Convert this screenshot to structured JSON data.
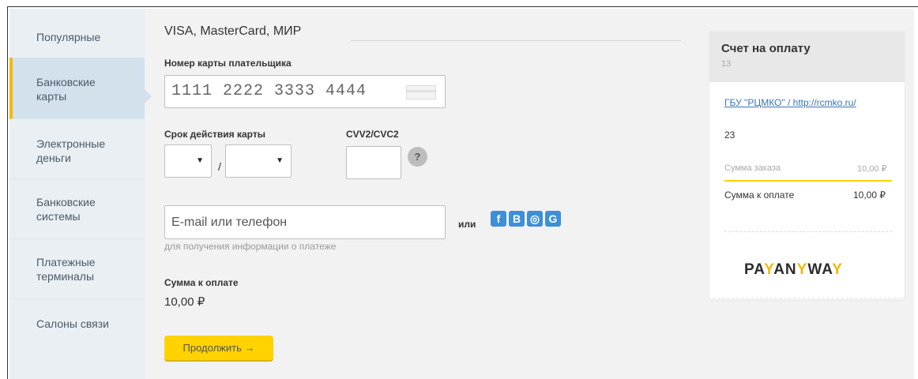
{
  "sidebar": {
    "items": [
      {
        "label": "Популярные"
      },
      {
        "label": "Банковские карты"
      },
      {
        "label": "Электронные деньги"
      },
      {
        "label": "Банковские системы"
      },
      {
        "label": "Платежные терминалы"
      },
      {
        "label": "Салоны связи"
      }
    ],
    "active_index": 1
  },
  "form": {
    "section_title": "VISA, MasterCard, МИР",
    "card_label": "Номер карты плательщика",
    "card_value": "1111 2222 3333 4444",
    "expiry_label": "Срок действия карты",
    "expiry_separator": "/",
    "cvv_label": "CVV2/CVC2",
    "help_symbol": "?",
    "email_placeholder": "E-mail или телефон",
    "or_label": "или",
    "social": [
      {
        "icon": "facebook-icon",
        "glyph": "f"
      },
      {
        "icon": "vk-icon",
        "glyph": "B"
      },
      {
        "icon": "odnoklassniki-icon",
        "glyph": "◎"
      },
      {
        "icon": "google-icon",
        "glyph": "G"
      }
    ],
    "email_hint": "для получения информации о платеже",
    "amount_label": "Сумма к оплате",
    "amount_value": "10,00 ₽",
    "continue_label": "Продолжить →"
  },
  "receipt": {
    "title": "Счет на оплату",
    "number": "13",
    "merchant": "ГБУ \"РЦМКО\" / http://rcmko.ru/",
    "description": "23",
    "order_sum_label": "Сумма заказа",
    "order_sum_value": "10,00 ₽",
    "pay_sum_label": "Сумма к оплате",
    "pay_sum_value": "10,00 ₽",
    "logo_text": "PAYANYWAY"
  },
  "colors": {
    "accent": "#ffd200",
    "social": "#3d8fd8",
    "link": "#3b74b7",
    "sidebar_active": "#d3e1ec"
  }
}
